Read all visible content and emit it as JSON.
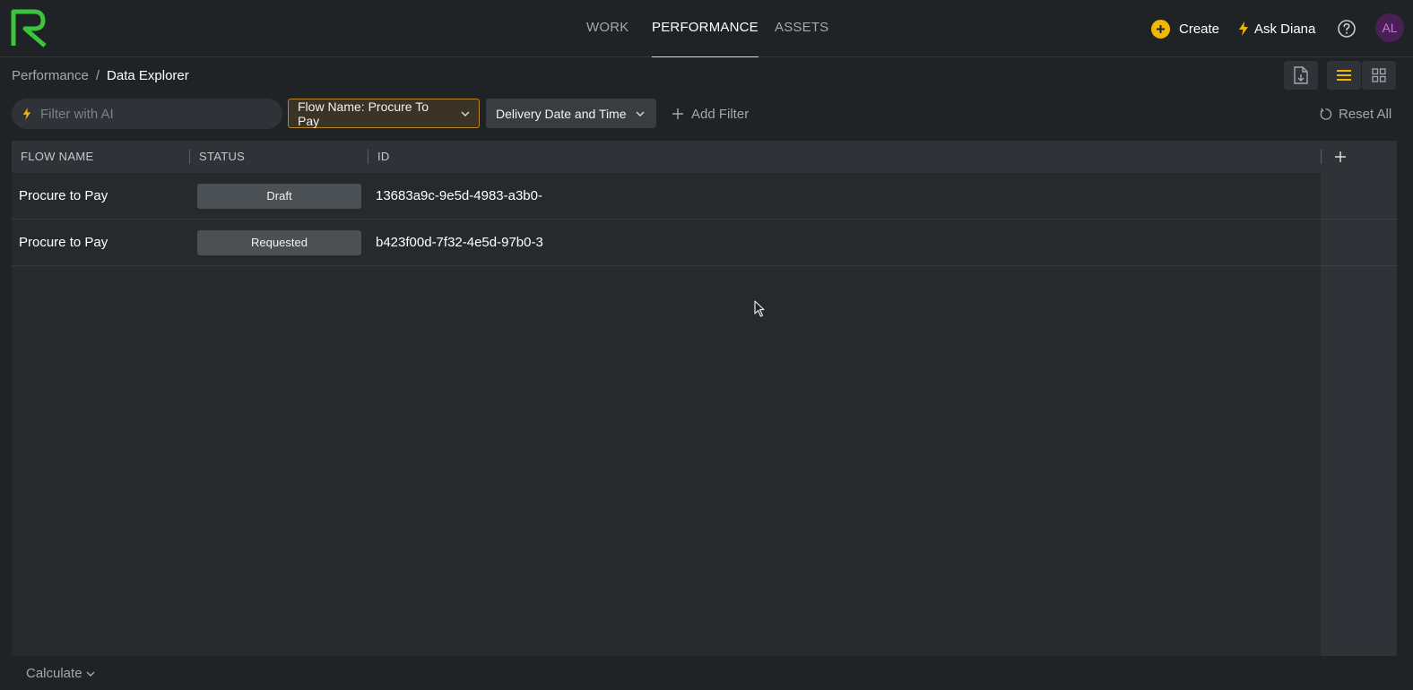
{
  "nav": {
    "tabs": [
      {
        "label": "WORK",
        "active": false
      },
      {
        "label": "PERFORMANCE",
        "active": true
      },
      {
        "label": "ASSETS",
        "active": false
      }
    ]
  },
  "actions": {
    "create_label": "Create",
    "ask_label": "Ask Diana",
    "avatar_initials": "AL",
    "help_icon": "question-circle-icon"
  },
  "breadcrumb": {
    "parent": "Performance",
    "separator": "/",
    "current": "Data Explorer"
  },
  "view_controls": {
    "export_icon": "file-download-icon",
    "list_icon": "list-view-icon",
    "grid_icon": "grid-view-icon",
    "active_view": "list"
  },
  "filters": {
    "ai_placeholder": "Filter with AI",
    "ai_value": "",
    "chips": [
      {
        "label": "Flow Name: Procure To Pay",
        "active": true
      },
      {
        "label": "Delivery Date and Time",
        "active": false
      }
    ],
    "add_filter_label": "Add Filter",
    "reset_label": "Reset All"
  },
  "table": {
    "columns": [
      "FLOW NAME",
      "STATUS",
      "ID"
    ],
    "rows": [
      {
        "flow_name": "Procure to Pay",
        "status": "Draft",
        "id": "13683a9c-9e5d-4983-a3b0-"
      },
      {
        "flow_name": "Procure to Pay",
        "status": "Requested",
        "id": "b423f00d-7f32-4e5d-97b0-3"
      }
    ]
  },
  "footer": {
    "calculate_label": "Calculate"
  },
  "colors": {
    "brand_green": "#3cc43c",
    "accent_yellow": "#f2b705",
    "active_chip_border": "#b8862a",
    "avatar_bg": "#4a1f55"
  }
}
